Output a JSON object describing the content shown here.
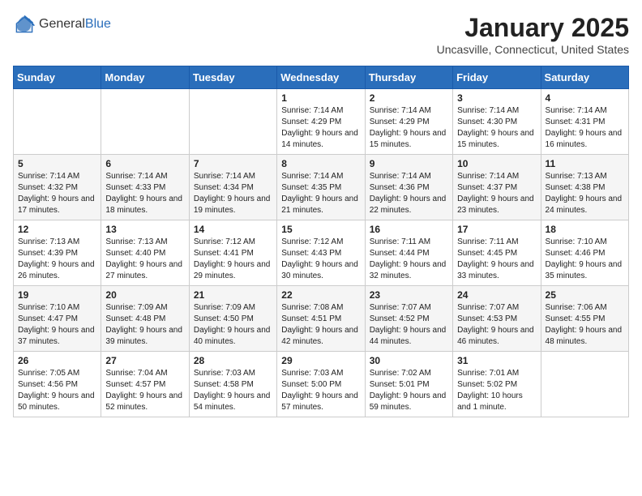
{
  "logo": {
    "general": "General",
    "blue": "Blue"
  },
  "header": {
    "month": "January 2025",
    "location": "Uncasville, Connecticut, United States"
  },
  "days_of_week": [
    "Sunday",
    "Monday",
    "Tuesday",
    "Wednesday",
    "Thursday",
    "Friday",
    "Saturday"
  ],
  "weeks": [
    [
      {
        "day": "",
        "sunrise": "",
        "sunset": "",
        "daylight": ""
      },
      {
        "day": "",
        "sunrise": "",
        "sunset": "",
        "daylight": ""
      },
      {
        "day": "",
        "sunrise": "",
        "sunset": "",
        "daylight": ""
      },
      {
        "day": "1",
        "sunrise": "Sunrise: 7:14 AM",
        "sunset": "Sunset: 4:29 PM",
        "daylight": "Daylight: 9 hours and 14 minutes."
      },
      {
        "day": "2",
        "sunrise": "Sunrise: 7:14 AM",
        "sunset": "Sunset: 4:29 PM",
        "daylight": "Daylight: 9 hours and 15 minutes."
      },
      {
        "day": "3",
        "sunrise": "Sunrise: 7:14 AM",
        "sunset": "Sunset: 4:30 PM",
        "daylight": "Daylight: 9 hours and 15 minutes."
      },
      {
        "day": "4",
        "sunrise": "Sunrise: 7:14 AM",
        "sunset": "Sunset: 4:31 PM",
        "daylight": "Daylight: 9 hours and 16 minutes."
      }
    ],
    [
      {
        "day": "5",
        "sunrise": "Sunrise: 7:14 AM",
        "sunset": "Sunset: 4:32 PM",
        "daylight": "Daylight: 9 hours and 17 minutes."
      },
      {
        "day": "6",
        "sunrise": "Sunrise: 7:14 AM",
        "sunset": "Sunset: 4:33 PM",
        "daylight": "Daylight: 9 hours and 18 minutes."
      },
      {
        "day": "7",
        "sunrise": "Sunrise: 7:14 AM",
        "sunset": "Sunset: 4:34 PM",
        "daylight": "Daylight: 9 hours and 19 minutes."
      },
      {
        "day": "8",
        "sunrise": "Sunrise: 7:14 AM",
        "sunset": "Sunset: 4:35 PM",
        "daylight": "Daylight: 9 hours and 21 minutes."
      },
      {
        "day": "9",
        "sunrise": "Sunrise: 7:14 AM",
        "sunset": "Sunset: 4:36 PM",
        "daylight": "Daylight: 9 hours and 22 minutes."
      },
      {
        "day": "10",
        "sunrise": "Sunrise: 7:14 AM",
        "sunset": "Sunset: 4:37 PM",
        "daylight": "Daylight: 9 hours and 23 minutes."
      },
      {
        "day": "11",
        "sunrise": "Sunrise: 7:13 AM",
        "sunset": "Sunset: 4:38 PM",
        "daylight": "Daylight: 9 hours and 24 minutes."
      }
    ],
    [
      {
        "day": "12",
        "sunrise": "Sunrise: 7:13 AM",
        "sunset": "Sunset: 4:39 PM",
        "daylight": "Daylight: 9 hours and 26 minutes."
      },
      {
        "day": "13",
        "sunrise": "Sunrise: 7:13 AM",
        "sunset": "Sunset: 4:40 PM",
        "daylight": "Daylight: 9 hours and 27 minutes."
      },
      {
        "day": "14",
        "sunrise": "Sunrise: 7:12 AM",
        "sunset": "Sunset: 4:41 PM",
        "daylight": "Daylight: 9 hours and 29 minutes."
      },
      {
        "day": "15",
        "sunrise": "Sunrise: 7:12 AM",
        "sunset": "Sunset: 4:43 PM",
        "daylight": "Daylight: 9 hours and 30 minutes."
      },
      {
        "day": "16",
        "sunrise": "Sunrise: 7:11 AM",
        "sunset": "Sunset: 4:44 PM",
        "daylight": "Daylight: 9 hours and 32 minutes."
      },
      {
        "day": "17",
        "sunrise": "Sunrise: 7:11 AM",
        "sunset": "Sunset: 4:45 PM",
        "daylight": "Daylight: 9 hours and 33 minutes."
      },
      {
        "day": "18",
        "sunrise": "Sunrise: 7:10 AM",
        "sunset": "Sunset: 4:46 PM",
        "daylight": "Daylight: 9 hours and 35 minutes."
      }
    ],
    [
      {
        "day": "19",
        "sunrise": "Sunrise: 7:10 AM",
        "sunset": "Sunset: 4:47 PM",
        "daylight": "Daylight: 9 hours and 37 minutes."
      },
      {
        "day": "20",
        "sunrise": "Sunrise: 7:09 AM",
        "sunset": "Sunset: 4:48 PM",
        "daylight": "Daylight: 9 hours and 39 minutes."
      },
      {
        "day": "21",
        "sunrise": "Sunrise: 7:09 AM",
        "sunset": "Sunset: 4:50 PM",
        "daylight": "Daylight: 9 hours and 40 minutes."
      },
      {
        "day": "22",
        "sunrise": "Sunrise: 7:08 AM",
        "sunset": "Sunset: 4:51 PM",
        "daylight": "Daylight: 9 hours and 42 minutes."
      },
      {
        "day": "23",
        "sunrise": "Sunrise: 7:07 AM",
        "sunset": "Sunset: 4:52 PM",
        "daylight": "Daylight: 9 hours and 44 minutes."
      },
      {
        "day": "24",
        "sunrise": "Sunrise: 7:07 AM",
        "sunset": "Sunset: 4:53 PM",
        "daylight": "Daylight: 9 hours and 46 minutes."
      },
      {
        "day": "25",
        "sunrise": "Sunrise: 7:06 AM",
        "sunset": "Sunset: 4:55 PM",
        "daylight": "Daylight: 9 hours and 48 minutes."
      }
    ],
    [
      {
        "day": "26",
        "sunrise": "Sunrise: 7:05 AM",
        "sunset": "Sunset: 4:56 PM",
        "daylight": "Daylight: 9 hours and 50 minutes."
      },
      {
        "day": "27",
        "sunrise": "Sunrise: 7:04 AM",
        "sunset": "Sunset: 4:57 PM",
        "daylight": "Daylight: 9 hours and 52 minutes."
      },
      {
        "day": "28",
        "sunrise": "Sunrise: 7:03 AM",
        "sunset": "Sunset: 4:58 PM",
        "daylight": "Daylight: 9 hours and 54 minutes."
      },
      {
        "day": "29",
        "sunrise": "Sunrise: 7:03 AM",
        "sunset": "Sunset: 5:00 PM",
        "daylight": "Daylight: 9 hours and 57 minutes."
      },
      {
        "day": "30",
        "sunrise": "Sunrise: 7:02 AM",
        "sunset": "Sunset: 5:01 PM",
        "daylight": "Daylight: 9 hours and 59 minutes."
      },
      {
        "day": "31",
        "sunrise": "Sunrise: 7:01 AM",
        "sunset": "Sunset: 5:02 PM",
        "daylight": "Daylight: 10 hours and 1 minute."
      },
      {
        "day": "",
        "sunrise": "",
        "sunset": "",
        "daylight": ""
      }
    ]
  ]
}
